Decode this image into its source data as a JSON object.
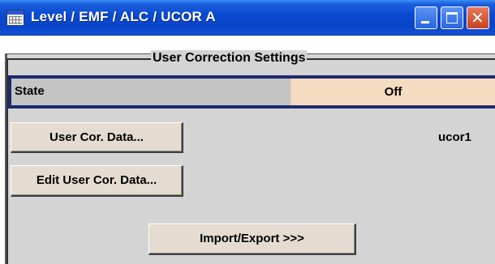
{
  "window": {
    "title": "Level / EMF / ALC / UCOR  A",
    "icons": {
      "app": "dialog-grid-icon",
      "minimize": "minimize-icon",
      "maximize": "maximize-icon",
      "close": "close-icon"
    },
    "colors": {
      "titlebar": "#0a48d0",
      "close_button": "#c8421e"
    }
  },
  "user_correction": {
    "group_title": "User Correction Settings",
    "state": {
      "label": "State",
      "value": "Off",
      "value_background": "#f5dcc0",
      "focus_border": "#1c2a6e"
    },
    "user_cor_data_button": "User Cor. Data...",
    "selected_file": "ucor1",
    "edit_user_cor_data_button": "Edit User Cor. Data...",
    "import_export_button": "Import/Export >>>"
  }
}
